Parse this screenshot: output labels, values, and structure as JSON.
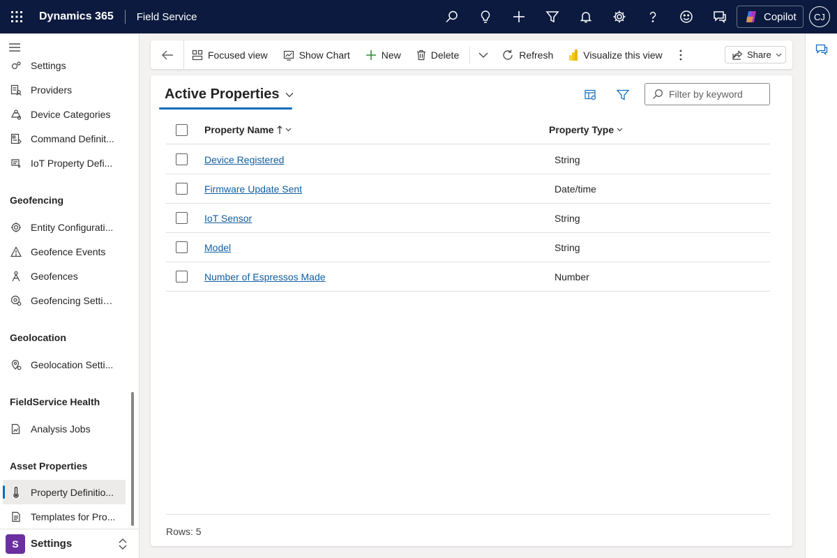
{
  "header": {
    "brand": "Dynamics 365",
    "app_name": "Field Service",
    "copilot_label": "Copilot",
    "user_initials": "CJ"
  },
  "sidebar": {
    "items_top": [
      {
        "label": "Settings",
        "icon": "settings-icon"
      },
      {
        "label": "Providers",
        "icon": "providers-icon"
      },
      {
        "label": "Device Categories",
        "icon": "device-categories-icon"
      },
      {
        "label": "Command Definit...",
        "icon": "command-definitions-icon"
      },
      {
        "label": "IoT Property Defi...",
        "icon": "iot-property-icon"
      }
    ],
    "groups": [
      {
        "title": "Geofencing",
        "items": [
          {
            "label": "Entity Configurati...",
            "icon": "gear-icon"
          },
          {
            "label": "Geofence Events",
            "icon": "warning-icon"
          },
          {
            "label": "Geofences",
            "icon": "geofence-icon"
          },
          {
            "label": "Geofencing Settin...",
            "icon": "geofencing-settings-icon"
          }
        ]
      },
      {
        "title": "Geolocation",
        "items": [
          {
            "label": "Geolocation Setti...",
            "icon": "geolocation-icon"
          }
        ]
      },
      {
        "title": "FieldService Health",
        "items": [
          {
            "label": "Analysis Jobs",
            "icon": "analysis-icon"
          }
        ]
      },
      {
        "title": "Asset Properties",
        "items": [
          {
            "label": "Property Definitio...",
            "icon": "thermometer-icon"
          },
          {
            "label": "Templates for Pro...",
            "icon": "document-icon"
          }
        ]
      }
    ],
    "area": {
      "badge": "S",
      "label": "Settings"
    }
  },
  "commandbar": {
    "focused_view": "Focused view",
    "show_chart": "Show Chart",
    "new": "New",
    "delete": "Delete",
    "refresh": "Refresh",
    "visualize": "Visualize this view",
    "share": "Share"
  },
  "view": {
    "title": "Active Properties",
    "filter_placeholder": "Filter by keyword"
  },
  "grid": {
    "columns": [
      "Property Name",
      "Property Type"
    ],
    "rows": [
      {
        "name": "Device Registered",
        "type": "String"
      },
      {
        "name": "Firmware Update Sent",
        "type": "Date/time"
      },
      {
        "name": "IoT Sensor",
        "type": "String"
      },
      {
        "name": "Model",
        "type": "String"
      },
      {
        "name": "Number of Espressos Made",
        "type": "Number"
      }
    ],
    "footer": "Rows: 5"
  },
  "colors": {
    "topbar": "#0b1a3e",
    "accent": "#0f6cbd",
    "link": "#115ea3",
    "area_badge": "#6b2fa0"
  }
}
